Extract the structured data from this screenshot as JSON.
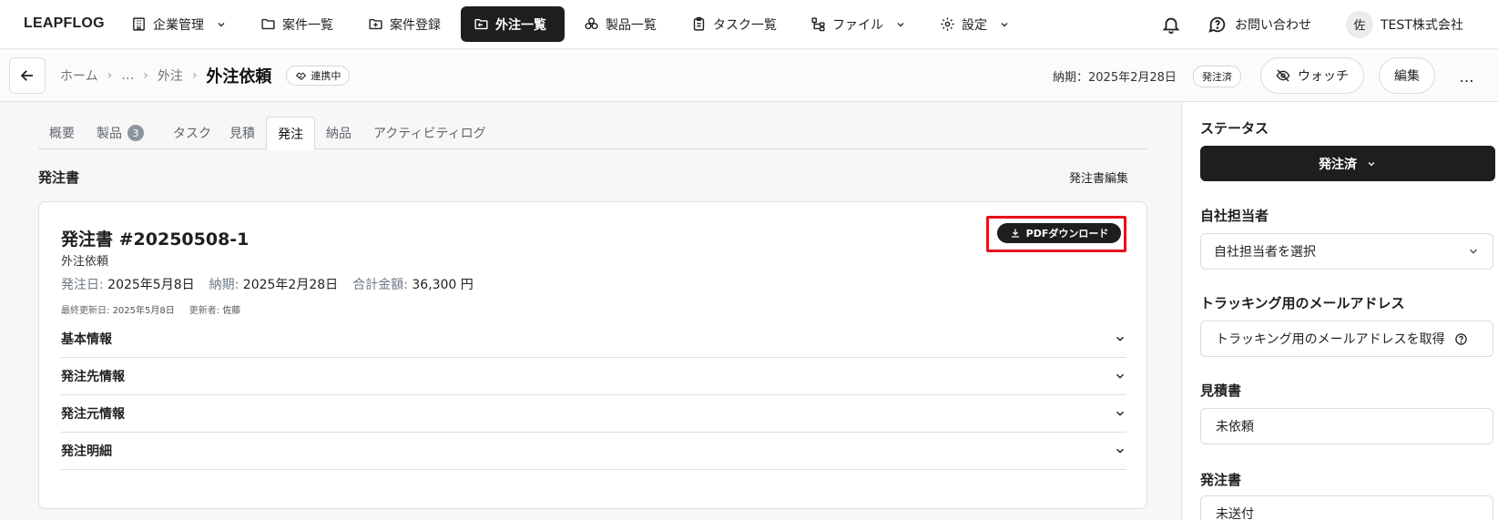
{
  "brand": "LEAPFLOG",
  "nav": {
    "items": [
      {
        "label": "企業管理",
        "icon": "building-icon",
        "dropdown": true
      },
      {
        "label": "案件一覧",
        "icon": "folder-icon",
        "dropdown": false
      },
      {
        "label": "案件登録",
        "icon": "folder-plus-icon",
        "dropdown": false
      },
      {
        "label": "外注一覧",
        "icon": "outsource-icon",
        "dropdown": false,
        "active": true
      },
      {
        "label": "製品一覧",
        "icon": "boxes-icon",
        "dropdown": false
      },
      {
        "label": "タスク一覧",
        "icon": "clipboard-icon",
        "dropdown": false
      },
      {
        "label": "ファイル",
        "icon": "file-tree-icon",
        "dropdown": true
      },
      {
        "label": "設定",
        "icon": "gear-icon",
        "dropdown": true
      }
    ],
    "contact_label": "お問い合わせ",
    "avatar_initial": "佐",
    "company_name": "TEST株式会社"
  },
  "subheader": {
    "breadcrumbs": [
      "ホーム",
      "…",
      "外注"
    ],
    "current": "外注依頼",
    "link_status": "連携中",
    "deadline": "納期：2025年2月28日",
    "status": "発注済",
    "watch_label": "ウォッチ",
    "edit_label": "編集",
    "more_label": "…"
  },
  "tabs": [
    {
      "label": "概要"
    },
    {
      "label": "製品",
      "badge": "3"
    },
    {
      "label": "タスク"
    },
    {
      "label": "見積"
    },
    {
      "label": "発注",
      "active": true
    },
    {
      "label": "納品"
    },
    {
      "label": "アクティビティログ"
    }
  ],
  "section": {
    "title": "発注書",
    "action": "発注書編集"
  },
  "order": {
    "title": "発注書 #20250508-1",
    "subtitle": "外注依頼",
    "order_date_label": "発注日:",
    "order_date": "2025年5月8日",
    "deadline_label": "納期:",
    "deadline": "2025年2月28日",
    "total_label": "合計金額:",
    "total": "36,300 円",
    "updated_label": "最終更新日:",
    "updated": "2025年5月8日",
    "updater_label": "更新者:",
    "updater": "佐藤",
    "pdf_label": "PDFダウンロード",
    "accordions": [
      "基本情報",
      "発注先情報",
      "発注元情報",
      "発注明細"
    ]
  },
  "sidebar": {
    "status_title": "ステータス",
    "status_value": "発注済",
    "assignee_title": "自社担当者",
    "assignee_placeholder": "自社担当者を選択",
    "tracking_title": "トラッキング用のメールアドレス",
    "tracking_button": "トラッキング用のメールアドレスを取得",
    "quote_title": "見積書",
    "quote_value": "未依頼",
    "po_title": "発注書",
    "po_value": "未送付"
  },
  "colors": {
    "active_bg": "#1d1e20",
    "highlight": "#e4111b",
    "badge_bg": "#8d959c"
  }
}
